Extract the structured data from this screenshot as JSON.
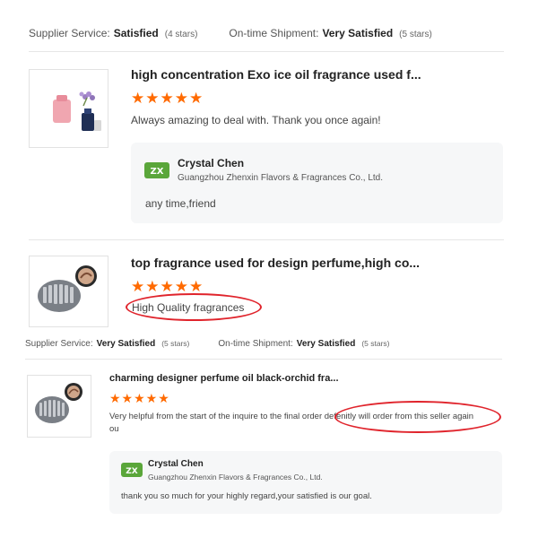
{
  "top_ratings": {
    "supplier_label": "Supplier Service:",
    "supplier_value": "Satisfied",
    "supplier_count": "(4 stars)",
    "shipment_label": "On-time Shipment:",
    "shipment_value": "Very Satisfied",
    "shipment_count": "(5 stars)"
  },
  "review1": {
    "title": "high concentration Exo ice oil fragrance used f...",
    "stars": "★★★★★",
    "text": "Always amazing to deal with. Thank you once again!",
    "reply": {
      "name": "Crystal Chen",
      "company": "Guangzhou Zhenxin Flavors & Fragrances Co., Ltd.",
      "text": "any time,friend"
    }
  },
  "review2": {
    "title": "top fragrance used for design perfume,high co...",
    "stars": "★★★★★",
    "text": "High Quality fragrances"
  },
  "bottom_ratings": {
    "supplier_label": "Supplier Service:",
    "supplier_value": "Very Satisfied",
    "supplier_count": "(5 stars)",
    "shipment_label": "On-time Shipment:",
    "shipment_value": "Very Satisfied",
    "shipment_count": "(5 stars)"
  },
  "review3": {
    "title": "charming designer perfume oil black-orchid fra...",
    "stars": "★★★★★",
    "text_line1_start": "Very helpful from the start of the inquire to the final order ",
    "text_line1_highlight": "defenitly will order from this seller again",
    "text_line2": "ou",
    "reply": {
      "name": "Crystal Chen",
      "company": "Guangzhou Zhenxin Flavors & Fragrances Co., Ltd.",
      "text": "thank you so much for your highly regard,your satisfied is our goal."
    }
  },
  "colors": {
    "star": "#ff6a00",
    "annotation_circle": "#e0242c",
    "logo_green": "#5aa63a",
    "reply_bg": "#f6f7f8"
  }
}
